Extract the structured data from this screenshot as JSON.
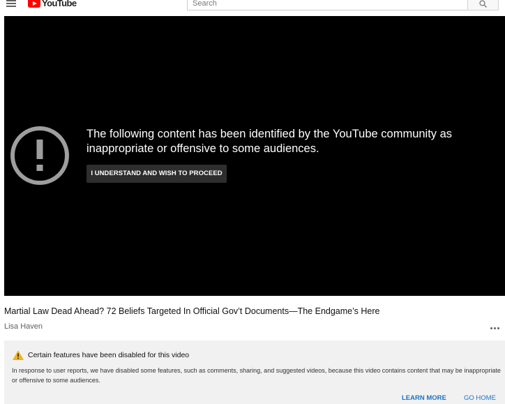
{
  "header": {
    "logo_text": "YouTube",
    "search_placeholder": "Search"
  },
  "player": {
    "warning_message": "The following content has been identified by the YouTube community as inappropriate or offensive to some audiences.",
    "proceed_button": "I UNDERSTAND AND WISH TO PROCEED"
  },
  "video": {
    "title": "Martial Law Dead Ahead? 72 Beliefs Targeted In Official Gov’t Documents—The Endgame’s Here",
    "channel": "Lisa Haven"
  },
  "notice": {
    "heading": "Certain features have been disabled for this video",
    "body": "In response to user reports, we have disabled some features, such as comments, sharing, and suggested videos, because this video contains content that may be inappropriate or offensive to some audiences.",
    "learn_more": "LEARN MORE",
    "go_home": "GO HOME"
  },
  "icons": {
    "menu": "hamburger-menu-icon",
    "search": "search-icon",
    "alert": "exclamation-circle-icon",
    "warning": "warning-triangle-icon",
    "more": "more-horizontal-icon"
  },
  "colors": {
    "brand_red": "#ff0000",
    "link_blue": "#1a73c8",
    "warning_yellow": "#f2b01e",
    "player_bg": "#000000"
  }
}
